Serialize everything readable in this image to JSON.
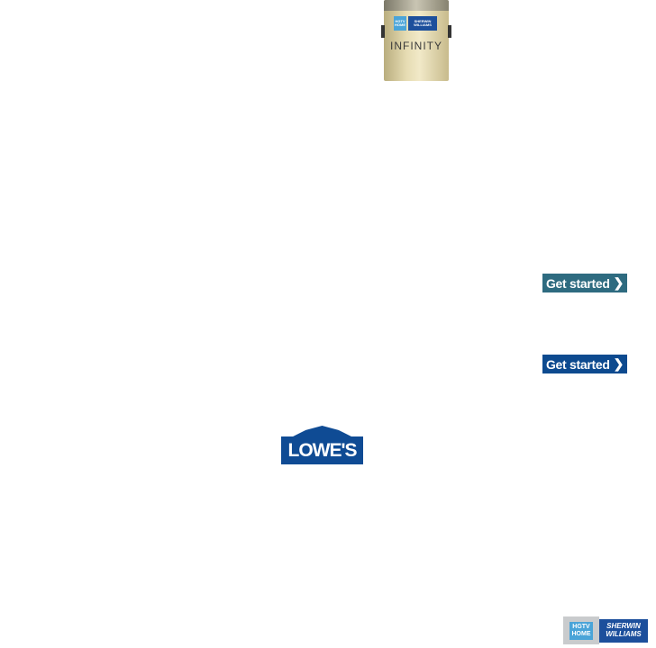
{
  "product": {
    "brand_left": "HGTV HOME",
    "brand_right": "SHERWIN WILLIAMS",
    "name": "INFINITY"
  },
  "cta": [
    {
      "label": "Get started",
      "icon": "chevron-right-icon",
      "color": "#2e6b80"
    },
    {
      "label": "Get started",
      "icon": "chevron-right-icon",
      "color": "#0d4a8f"
    }
  ],
  "retailer": {
    "name": "LOWE'S",
    "color": "#0f4b94"
  },
  "footer_logo": {
    "left": "HGTV HOME",
    "right": "SHERWIN WILLIAMS"
  }
}
